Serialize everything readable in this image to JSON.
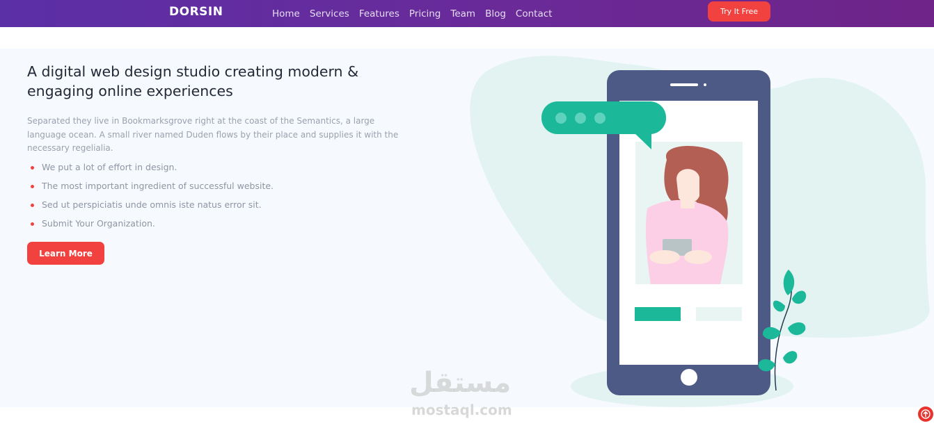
{
  "navbar": {
    "brand": "DORSIN",
    "links": [
      "Home",
      "Services",
      "Features",
      "Pricing",
      "Team",
      "Blog",
      "Contact"
    ],
    "cta_label": "Try It Free"
  },
  "hero": {
    "headline_line1": "A digital web design studio creating modern &",
    "headline_line2": "engaging online experiences",
    "intro": "Separated they live in Bookmarksgrove right at the coast of the Semantics, a large language ocean. A small river named Duden flows by their place and supplies it with the necessary regelialia.",
    "features": [
      "We put a lot of effort in design.",
      "The most important ingredient of successful website.",
      "Sed ut perspiciatis unde omnis iste natus error sit.",
      "Submit Your Organization."
    ],
    "button_label": "Learn More"
  },
  "watermark": {
    "arabic": "مستقل",
    "latin": "mostaql.com"
  },
  "colors": {
    "nav_start": "#5b2fa6",
    "nav_end": "#6e2488",
    "accent_red": "#f2423f",
    "teal": "#1bb99a",
    "phone_body": "#4e5a86",
    "hero_bg": "#f6fafe"
  },
  "icons": {
    "back_to_top": "arrow-up-circle-icon",
    "chat": "chat-bubble-icon"
  }
}
